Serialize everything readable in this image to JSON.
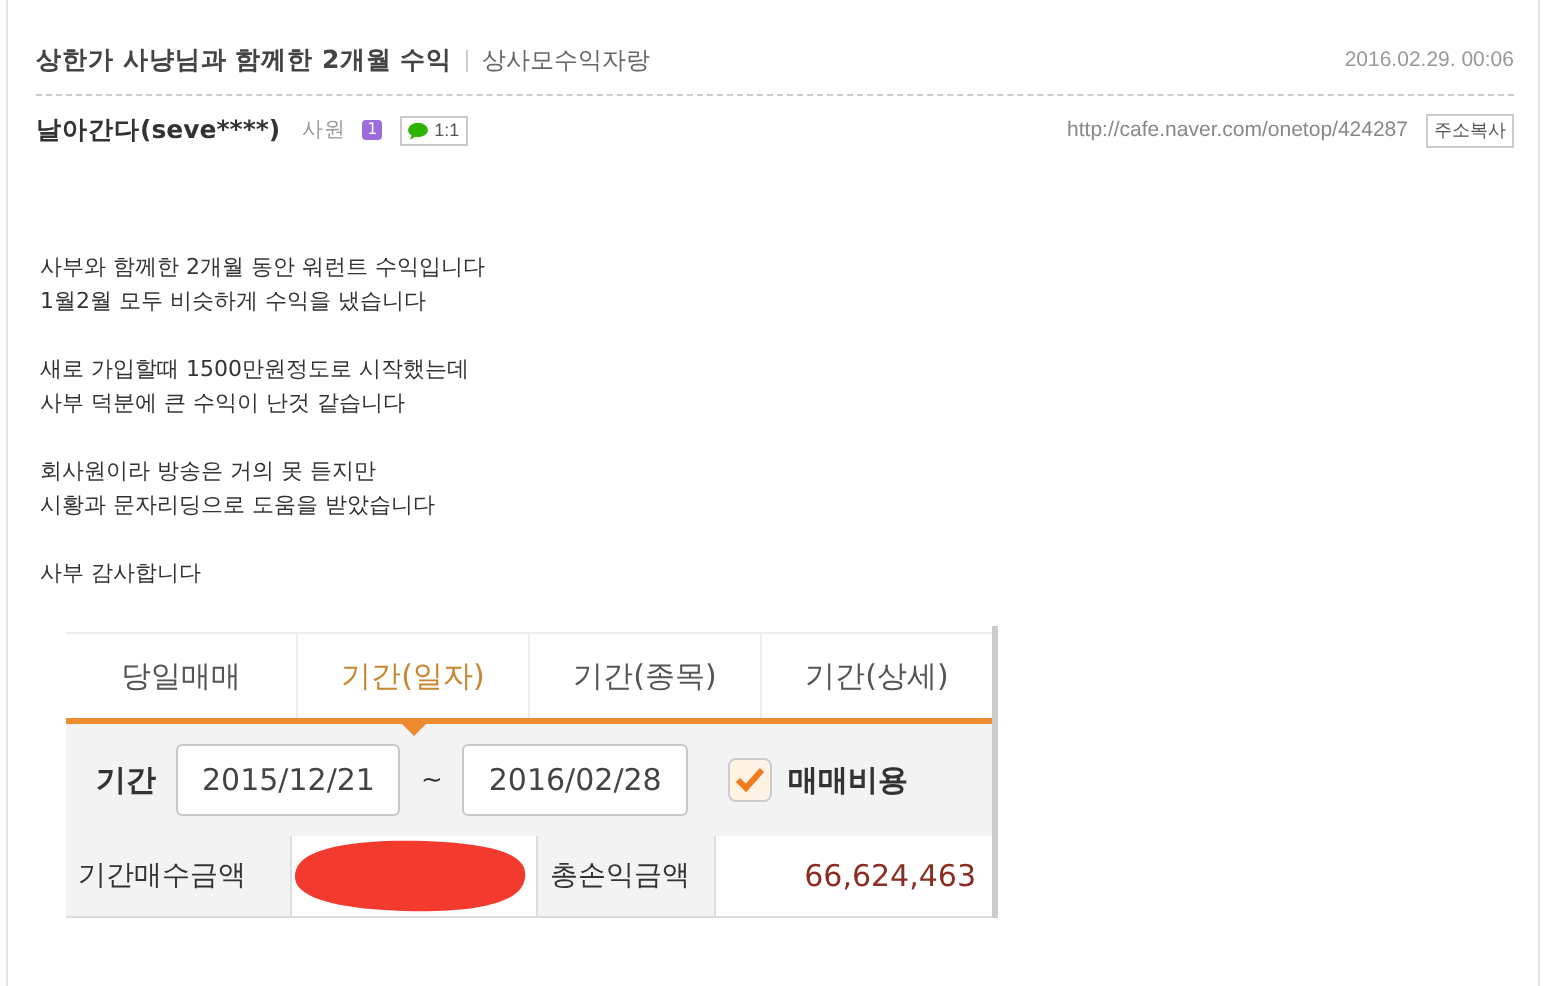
{
  "post": {
    "title": "상한가 사냥님과 함께한 2개월 수익",
    "board": "상사모수익자랑",
    "date": "2016.02.29. 00:06"
  },
  "author": {
    "nickname": "날아간다(seve****)",
    "rank": "사원",
    "level_badge": "1",
    "chat_label": "1:1",
    "url": "http://cafe.naver.com/onetop/424287",
    "copy_button": "주소복사"
  },
  "paragraphs": [
    [
      "사부와 함께한 2개월 동안 워런트 수익입니다",
      "1월2월 모두 비슷하게 수익을 냈습니다"
    ],
    [
      "새로 가입할때 1500만원정도로 시작했는데",
      "사부 덕분에 큰 수익이 난것 같습니다"
    ],
    [
      "회사원이라 방송은 거의 못 듣지만",
      "시황과 문자리딩으로 도움을 받았습니다"
    ],
    [
      "사부 감사합니다"
    ]
  ],
  "screenshot": {
    "tabs": [
      {
        "label": "당일매매",
        "selected": false
      },
      {
        "label": "기간(일자)",
        "selected": true
      },
      {
        "label": "기간(종목)",
        "selected": false
      },
      {
        "label": "기간(상세)",
        "selected": false
      }
    ],
    "period_label": "기간",
    "start_date": "2015/12/21",
    "separator": "~",
    "end_date": "2016/02/28",
    "fee_checkbox": {
      "label": "매매비용",
      "checked": true
    },
    "buy_amount_label": "기간매수금액",
    "total_profit_label": "총손익금액",
    "total_profit": "66,624,463"
  }
}
